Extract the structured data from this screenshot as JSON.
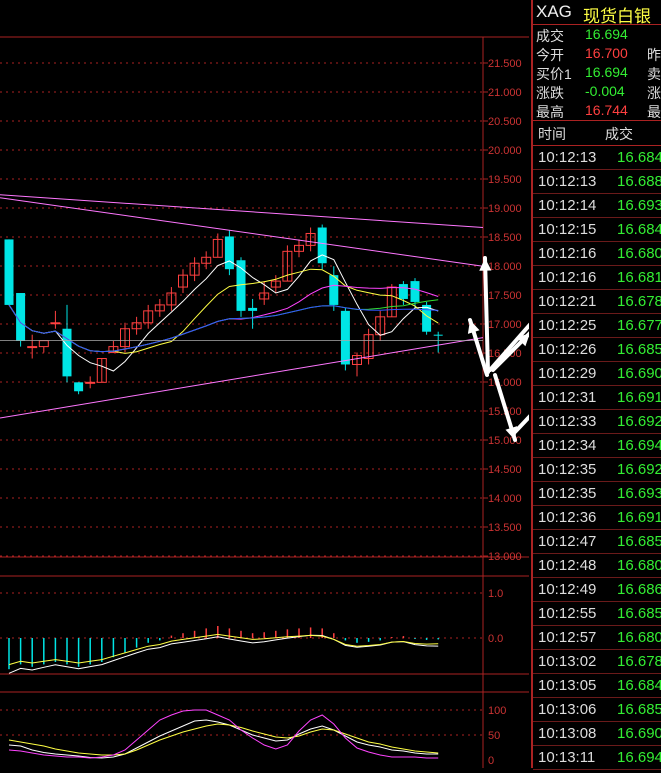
{
  "colors": {
    "up": "#ff4040",
    "down": "#00e5e5",
    "green_text": "#33ee33",
    "red_text": "#ff4040",
    "grid": "#aa2222",
    "axis_text": "#cc3333",
    "yellow": "#ffff66",
    "magenta": "#ff55ff",
    "arrow": "#ffffff"
  },
  "header": {
    "symbol": "XAG",
    "name": "现货白银"
  },
  "quote": [
    {
      "label": "成交",
      "value": "16.694",
      "color": "green",
      "cut": ""
    },
    {
      "label": "今开",
      "value": "16.700",
      "color": "red",
      "cut": "昨"
    },
    {
      "label": "买价1",
      "value": "16.694",
      "color": "green",
      "cut": "卖"
    },
    {
      "label": "涨跌",
      "value": "-0.004",
      "color": "green",
      "cut": "涨"
    },
    {
      "label": "最高",
      "value": "16.744",
      "color": "red",
      "cut": "最"
    }
  ],
  "ticks_header": {
    "time": "时间",
    "price": "成交"
  },
  "ticks": [
    {
      "time": "10:12:13",
      "price": "16.684"
    },
    {
      "time": "10:12:13",
      "price": "16.688"
    },
    {
      "time": "10:12:14",
      "price": "16.693"
    },
    {
      "time": "10:12:15",
      "price": "16.684"
    },
    {
      "time": "10:12:16",
      "price": "16.680"
    },
    {
      "time": "10:12:16",
      "price": "16.681"
    },
    {
      "time": "10:12:21",
      "price": "16.678"
    },
    {
      "time": "10:12:25",
      "price": "16.677"
    },
    {
      "time": "10:12:26",
      "price": "16.685"
    },
    {
      "time": "10:12:29",
      "price": "16.690"
    },
    {
      "time": "10:12:31",
      "price": "16.691"
    },
    {
      "time": "10:12:33",
      "price": "16.692"
    },
    {
      "time": "10:12:34",
      "price": "16.694"
    },
    {
      "time": "10:12:35",
      "price": "16.692"
    },
    {
      "time": "10:12:35",
      "price": "16.693"
    },
    {
      "time": "10:12:36",
      "price": "16.691"
    },
    {
      "time": "10:12:47",
      "price": "16.685"
    },
    {
      "time": "10:12:48",
      "price": "16.680"
    },
    {
      "time": "10:12:49",
      "price": "16.686"
    },
    {
      "time": "10:12:55",
      "price": "16.685"
    },
    {
      "time": "10:12:57",
      "price": "16.680"
    },
    {
      "time": "10:13:02",
      "price": "16.678"
    },
    {
      "time": "10:13:05",
      "price": "16.684"
    },
    {
      "time": "10:13:06",
      "price": "16.685"
    },
    {
      "time": "10:13:08",
      "price": "16.690"
    },
    {
      "time": "10:13:11",
      "price": "16.694"
    }
  ],
  "axis": {
    "price_labels": [
      "21.500",
      "21.000",
      "20.500",
      "20.000",
      "19.500",
      "19.000",
      "18.500",
      "18.000",
      "17.500",
      "17.000",
      "16.500",
      "16.000",
      "15.500",
      "15.000",
      "14.500",
      "14.000",
      "13.500",
      "13.000"
    ],
    "macd_labels": [
      "1.0",
      "0.0"
    ],
    "kdj_labels": [
      "100",
      "50",
      "0"
    ]
  },
  "candles": [
    {
      "o": 18.3,
      "h": 18.3,
      "l": 17.2,
      "c": 17.2
    },
    {
      "o": 17.4,
      "h": 17.4,
      "l": 16.5,
      "c": 16.6
    },
    {
      "o": 16.5,
      "h": 16.7,
      "l": 16.3,
      "c": 16.5
    },
    {
      "o": 16.5,
      "h": 16.5,
      "l": 16.4,
      "c": 16.6
    },
    {
      "o": 16.9,
      "h": 17.1,
      "l": 16.8,
      "c": 16.9
    },
    {
      "o": 16.8,
      "h": 17.2,
      "l": 15.9,
      "c": 16.0
    },
    {
      "o": 15.9,
      "h": 15.9,
      "l": 15.7,
      "c": 15.75
    },
    {
      "o": 15.9,
      "h": 16.0,
      "l": 15.8,
      "c": 15.9
    },
    {
      "o": 15.9,
      "h": 16.3,
      "l": 15.9,
      "c": 16.3
    },
    {
      "o": 16.4,
      "h": 16.6,
      "l": 16.4,
      "c": 16.5
    },
    {
      "o": 16.5,
      "h": 16.9,
      "l": 16.4,
      "c": 16.8
    },
    {
      "o": 16.8,
      "h": 17.0,
      "l": 16.7,
      "c": 16.9
    },
    {
      "o": 16.9,
      "h": 17.2,
      "l": 16.8,
      "c": 17.1
    },
    {
      "o": 17.1,
      "h": 17.3,
      "l": 17.0,
      "c": 17.2
    },
    {
      "o": 17.2,
      "h": 17.5,
      "l": 17.1,
      "c": 17.4
    },
    {
      "o": 17.5,
      "h": 17.8,
      "l": 17.4,
      "c": 17.7
    },
    {
      "o": 17.7,
      "h": 18.0,
      "l": 17.6,
      "c": 17.9
    },
    {
      "o": 17.9,
      "h": 18.1,
      "l": 17.8,
      "c": 18.0
    },
    {
      "o": 18.0,
      "h": 18.4,
      "l": 18.0,
      "c": 18.3
    },
    {
      "o": 18.35,
      "h": 18.45,
      "l": 17.7,
      "c": 17.8
    },
    {
      "o": 17.95,
      "h": 18.0,
      "l": 17.0,
      "c": 17.1
    },
    {
      "o": 17.15,
      "h": 17.3,
      "l": 16.8,
      "c": 17.1
    },
    {
      "o": 17.3,
      "h": 17.6,
      "l": 17.2,
      "c": 17.4
    },
    {
      "o": 17.5,
      "h": 17.7,
      "l": 17.4,
      "c": 17.6
    },
    {
      "o": 17.6,
      "h": 18.2,
      "l": 17.6,
      "c": 18.1
    },
    {
      "o": 18.1,
      "h": 18.3,
      "l": 18.0,
      "c": 18.2
    },
    {
      "o": 18.2,
      "h": 18.5,
      "l": 18.1,
      "c": 18.4
    },
    {
      "o": 18.5,
      "h": 18.55,
      "l": 17.8,
      "c": 17.9
    },
    {
      "o": 17.7,
      "h": 17.85,
      "l": 17.1,
      "c": 17.2
    },
    {
      "o": 17.1,
      "h": 17.15,
      "l": 16.1,
      "c": 16.2
    },
    {
      "o": 16.2,
      "h": 16.4,
      "l": 16.0,
      "c": 16.35
    },
    {
      "o": 16.3,
      "h": 16.8,
      "l": 16.2,
      "c": 16.7
    },
    {
      "o": 16.7,
      "h": 17.1,
      "l": 16.6,
      "c": 17.0
    },
    {
      "o": 17.0,
      "h": 17.55,
      "l": 17.0,
      "c": 17.5
    },
    {
      "o": 17.55,
      "h": 17.6,
      "l": 17.2,
      "c": 17.3
    },
    {
      "o": 17.6,
      "h": 17.65,
      "l": 17.15,
      "c": 17.25
    },
    {
      "o": 17.2,
      "h": 17.25,
      "l": 16.7,
      "c": 16.75
    },
    {
      "o": 16.7,
      "h": 16.75,
      "l": 16.4,
      "c": 16.69
    }
  ],
  "macd_hist": [
    -0.65,
    -0.55,
    -0.6,
    -0.55,
    -0.5,
    -0.55,
    -0.6,
    -0.55,
    -0.5,
    -0.4,
    -0.3,
    -0.2,
    -0.1,
    -0.05,
    0.05,
    0.1,
    0.15,
    0.2,
    0.25,
    0.2,
    0.15,
    0.1,
    0.12,
    0.15,
    0.18,
    0.2,
    0.22,
    0.2,
    0.1,
    -0.05,
    -0.1,
    -0.08,
    -0.05,
    0.02,
    0.04,
    -0.02,
    -0.04,
    -0.03
  ],
  "kdj": {
    "k": [
      30,
      28,
      20,
      15,
      12,
      10,
      8,
      5,
      4,
      6,
      12,
      24,
      36,
      48,
      58,
      68,
      78,
      80,
      76,
      70,
      60,
      50,
      44,
      38,
      40,
      52,
      62,
      68,
      60,
      48,
      36,
      30,
      26,
      20,
      18,
      14,
      12,
      12
    ],
    "d": [
      40,
      36,
      32,
      28,
      22,
      18,
      14,
      12,
      10,
      10,
      12,
      20,
      30,
      40,
      48,
      56,
      62,
      68,
      72,
      70,
      65,
      58,
      52,
      46,
      44,
      48,
      56,
      62,
      60,
      52,
      44,
      36,
      32,
      26,
      22,
      18,
      16,
      14
    ],
    "j": [
      20,
      18,
      14,
      10,
      8,
      6,
      6,
      4,
      6,
      10,
      20,
      40,
      60,
      80,
      90,
      98,
      100,
      100,
      90,
      80,
      60,
      44,
      30,
      22,
      30,
      58,
      80,
      90,
      72,
      44,
      24,
      16,
      10,
      6,
      6,
      6,
      4,
      4
    ]
  }
}
